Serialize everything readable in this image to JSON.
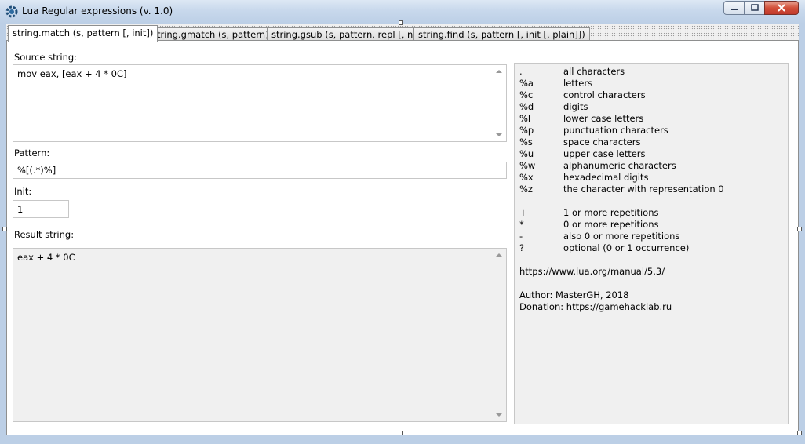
{
  "window": {
    "title": "Lua Regular expressions (v. 1.0)"
  },
  "tabs": [
    {
      "label": "string.match (s, pattern [, init])"
    },
    {
      "label": "string.gmatch (s, pattern)"
    },
    {
      "label": "string.gsub (s, pattern, repl [, n])"
    },
    {
      "label": "string.find (s, pattern [, init [, plain]])"
    }
  ],
  "form": {
    "source_label": "Source string:",
    "source_value": "mov eax, [eax + 4 * 0C]",
    "pattern_label": "Pattern:",
    "pattern_value": "%[(.*)%]",
    "init_label": "Init:",
    "init_value": "1",
    "result_label": "Result string:",
    "result_value": "eax + 4 * 0C"
  },
  "help": {
    "classes": [
      {
        "key": ".",
        "desc": "all characters"
      },
      {
        "key": "%a",
        "desc": "letters"
      },
      {
        "key": "%c",
        "desc": "control characters"
      },
      {
        "key": "%d",
        "desc": "digits"
      },
      {
        "key": "%l",
        "desc": "lower case letters"
      },
      {
        "key": "%p",
        "desc": "punctuation characters"
      },
      {
        "key": "%s",
        "desc": "space characters"
      },
      {
        "key": "%u",
        "desc": "upper case letters"
      },
      {
        "key": "%w",
        "desc": "alphanumeric characters"
      },
      {
        "key": "%x",
        "desc": "hexadecimal digits"
      },
      {
        "key": "%z",
        "desc": "the character with representation 0"
      }
    ],
    "repetitions": [
      {
        "key": "+",
        "desc": "1 or more repetitions"
      },
      {
        "key": "*",
        "desc": "0 or more repetitions"
      },
      {
        "key": "-",
        "desc": "also 0 or more repetitions"
      },
      {
        "key": "?",
        "desc": "optional (0 or 1 occurrence)"
      }
    ],
    "manual_url": "https://www.lua.org/manual/5.3/",
    "author": "Author: MasterGH, 2018",
    "donation": "Donation: https://gamehacklab.ru"
  }
}
